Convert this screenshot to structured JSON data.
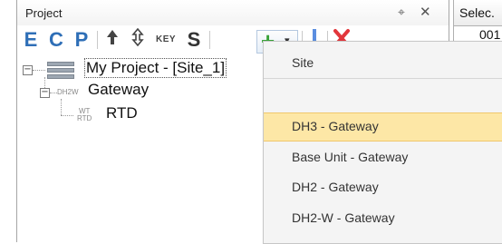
{
  "panel": {
    "title": "Project",
    "pin_icon": "pin-icon",
    "close_icon": "close-icon"
  },
  "toolbar": {
    "buttons": [
      {
        "label": "E",
        "color": "#2f6fb7"
      },
      {
        "label": "C",
        "color": "#2f6fb7"
      },
      {
        "label": "P",
        "color": "#2f6fb7"
      },
      {
        "label": "KEY",
        "color": "#444444"
      },
      {
        "label": "S",
        "color": "#333333"
      }
    ],
    "icons": [
      "arrow-up-icon",
      "move-icon",
      "add-icon",
      "chevron-down-icon",
      "insert-cursor-icon",
      "delete-icon"
    ],
    "accent_add": "#3aa338",
    "accent_delete": "#e2363b",
    "accent_cursor": "#5b8ee0"
  },
  "tree": {
    "root_label": "My Project - [Site_1]",
    "child_tag": "DH2W",
    "child_label": "Gateway",
    "grandchild_tag_top": "WT",
    "grandchild_tag_bottom": "RTD",
    "grandchild_label": "RTD"
  },
  "menu": {
    "header": "Site",
    "items": [
      {
        "label": "DH3 - Gateway",
        "highlighted": true
      },
      {
        "label": "Base Unit - Gateway",
        "highlighted": false
      },
      {
        "label": "DH2 - Gateway",
        "highlighted": false
      },
      {
        "label": "DH2-W - Gateway",
        "highlighted": false
      }
    ],
    "highlight_color": "#fde7a6"
  },
  "grid": {
    "header": "Selec.",
    "cell": "001"
  }
}
